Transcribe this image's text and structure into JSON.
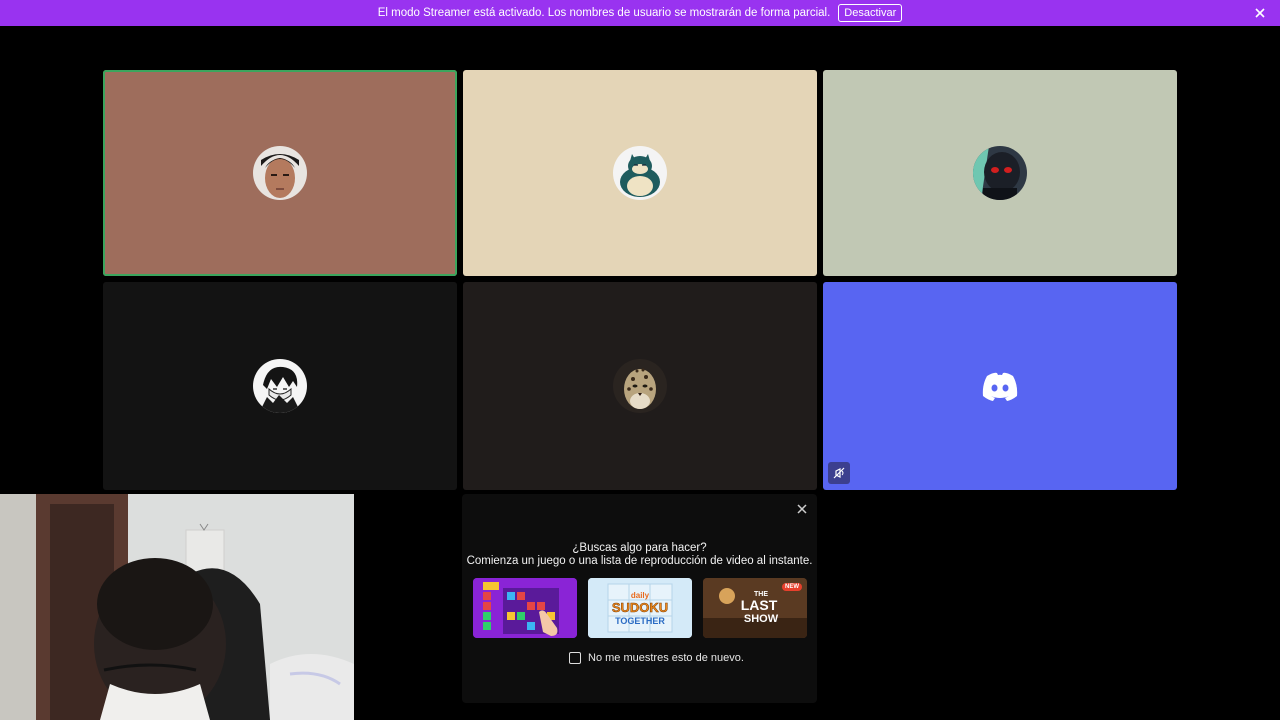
{
  "banner": {
    "message": "El modo Streamer está activado. Los nombres de usuario se mostrarán de forma parcial.",
    "button_label": "Desactivar",
    "color": "#9933f0"
  },
  "tiles": [
    {
      "bg": "#9e6d5c",
      "avatar": "photo-face"
    },
    {
      "bg": "#e4d5b7",
      "avatar": "snorlax"
    },
    {
      "bg": "#c1c8b4",
      "avatar": "dark-character"
    },
    {
      "bg": "#131313",
      "avatar": "manga-character"
    },
    {
      "bg": "#201c1b",
      "avatar": "leopard"
    },
    {
      "bg": "#5865f2",
      "avatar": "discord-logo"
    }
  ],
  "activity_popup": {
    "title": "¿Buscas algo para hacer?",
    "subtitle": "Comienza un juego o una lista de reproducción de video al instante.",
    "games": [
      {
        "name": "blocks-game"
      },
      {
        "name": "sudoku-together",
        "art_text_1": "daily",
        "art_text_2": "SUDOKU",
        "art_text_3": "TOGETHER"
      },
      {
        "name": "last-show",
        "art_text_1": "THE",
        "art_text_2": "LAST",
        "art_text_3": "SHOW",
        "badge": "NEW"
      }
    ],
    "checkbox_label": "No me muestres esto de nuevo."
  }
}
